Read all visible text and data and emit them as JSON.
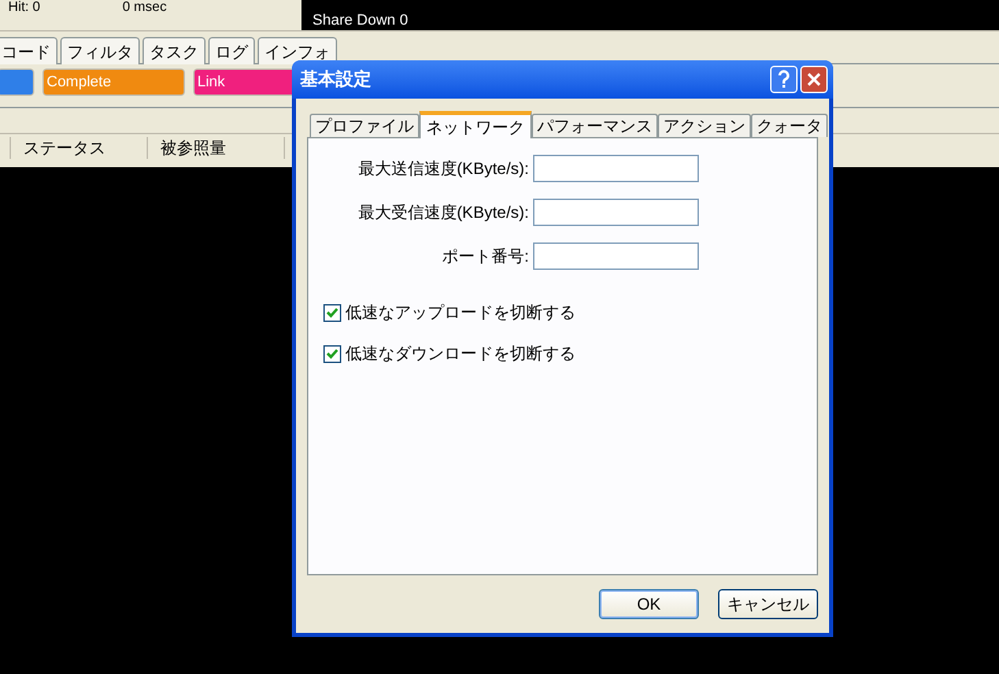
{
  "status": {
    "hit": "Hit: 0",
    "latency": "0 msec",
    "share_down": "Share Down 0"
  },
  "main_tabs": [
    {
      "label": "コード"
    },
    {
      "label": "フィルタ"
    },
    {
      "label": "タスク"
    },
    {
      "label": "ログ"
    },
    {
      "label": "インフォ"
    }
  ],
  "filters": [
    {
      "color": "#2f7fe8"
    },
    {
      "label": "Complete",
      "color": "#f08a10"
    },
    {
      "label": "Link",
      "color": "#f0207e"
    }
  ],
  "columns": [
    "ステータス",
    "被参照量"
  ],
  "dialog": {
    "title": "基本設定",
    "tabs": [
      {
        "label": "プロファイル",
        "selected": false
      },
      {
        "label": "ネットワーク",
        "selected": true
      },
      {
        "label": "パフォーマンス",
        "selected": false
      },
      {
        "label": "アクション",
        "selected": false
      },
      {
        "label": "クォータ",
        "selected": false
      }
    ],
    "fields": [
      {
        "label": "最大送信速度(KByte/s):"
      },
      {
        "label": "最大受信速度(KByte/s):"
      },
      {
        "label": "ポート番号:"
      }
    ],
    "checkboxes": [
      {
        "label": "低速なアップロードを切断する",
        "checked": true
      },
      {
        "label": "低速なダウンロードを切断する",
        "checked": true
      }
    ],
    "buttons": [
      "OK",
      "キャンセル"
    ]
  }
}
